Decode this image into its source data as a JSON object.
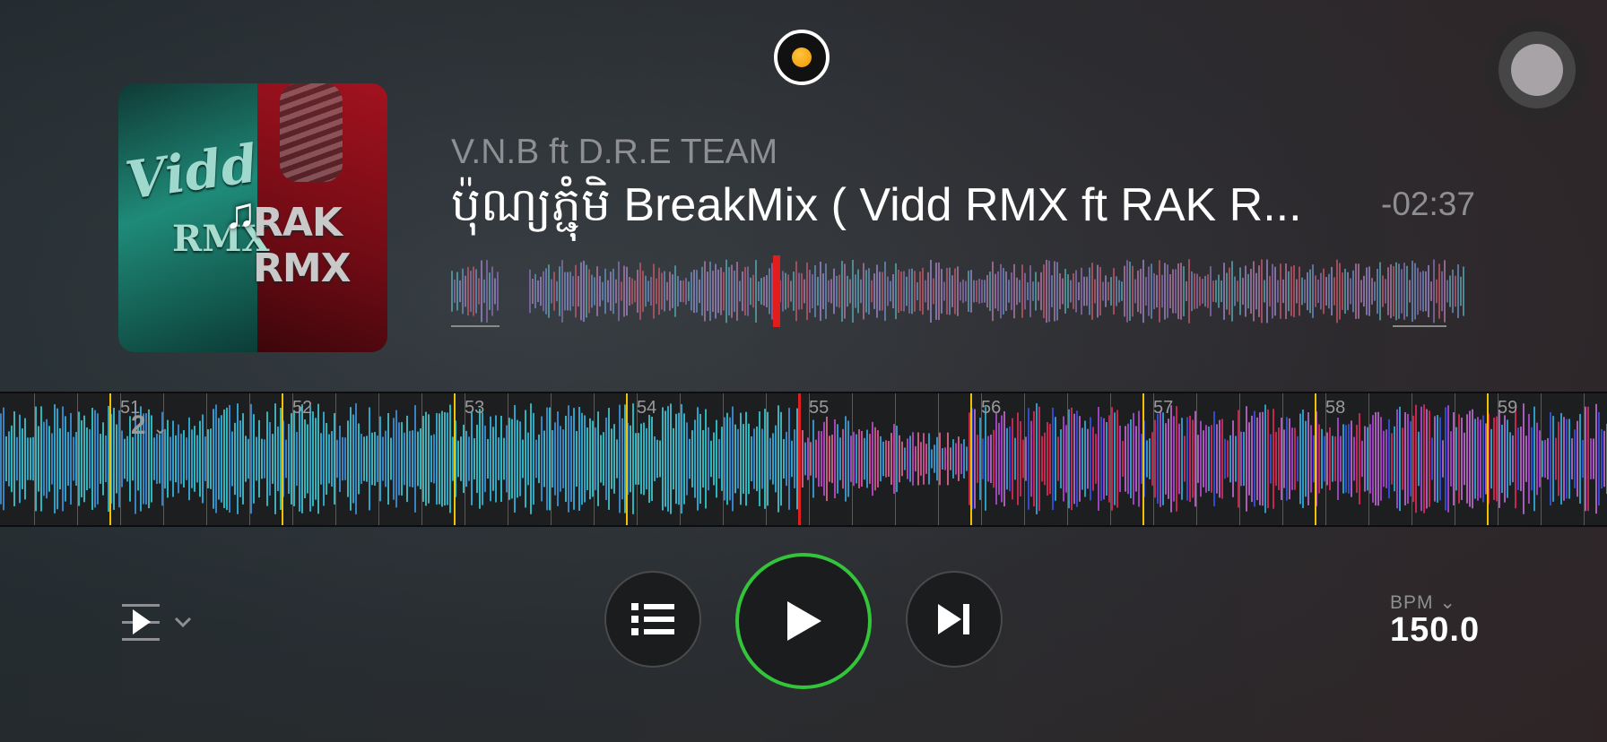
{
  "track": {
    "artist": "V.N.B ft D.R.E TEAM",
    "title": "ប៉ុណ្យភ្ជុំមិ BreakMix ( Vidd RMX ft RAK R...",
    "remaining_time": "-02:37",
    "album_art": {
      "left_text": "Vidd",
      "left_text2": "RMX",
      "right_text": "RAK RMX",
      "note_icon": "music-note-icon"
    }
  },
  "overview": {
    "playhead_fraction": 0.318,
    "colors": {
      "playhead": "#e11d1d"
    }
  },
  "timeline": {
    "beat_markers": [
      "51",
      "52",
      "53",
      "54",
      "55",
      "56",
      "57",
      "58",
      "59"
    ],
    "loop_size": "2",
    "colors": {
      "marker": "#f2c200",
      "playhead": "#e11d1d"
    }
  },
  "controls": {
    "queue_toggle_icon": "queue-play-icon",
    "list_icon": "list-icon",
    "play_icon": "play-icon",
    "next_icon": "skip-next-icon",
    "record_icon": "record-icon",
    "assistive_icon": "assistive-touch-icon",
    "play_ring_color": "#33c43a"
  },
  "bpm": {
    "label": "BPM",
    "value": "150.0"
  }
}
